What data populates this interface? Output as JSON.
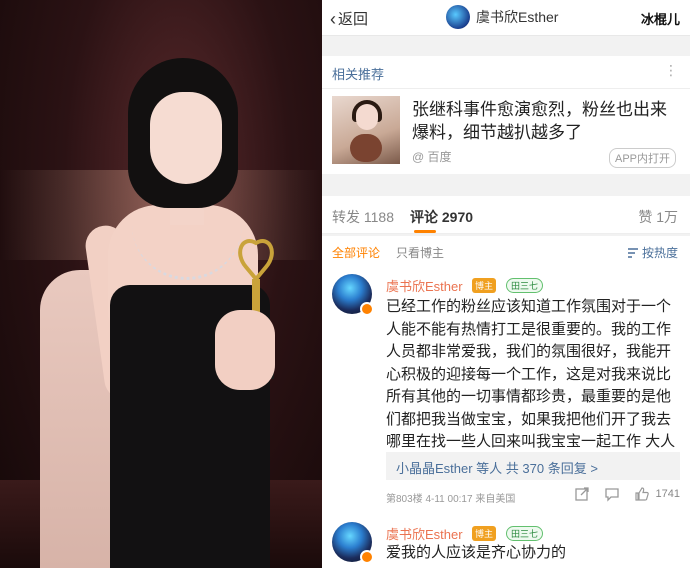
{
  "nav": {
    "back_label": "返回",
    "user_name": "虞书欣Esther",
    "watermark": "冰棍儿"
  },
  "recommend": {
    "header": "相关推荐",
    "title": "张继科事件愈演愈烈，粉丝也出来爆料，细节越扒越多了",
    "source": "@ 百度",
    "badge": "APP内打开"
  },
  "stats": {
    "repost": "转发 1188",
    "comments": "评论 2970",
    "likes": "赞 1万"
  },
  "filters": {
    "all": "全部评论",
    "owner_only": "只看博主",
    "sort": "按热度"
  },
  "comments": [
    {
      "name": "虞书欣Esther",
      "owner_tag": "博主",
      "fan_tag": "田三七",
      "text": "已经工作的粉丝应该知道工作氛围对于一个人能不能有热情打工是很重要的。我的工作人员都非常爱我，我们的氛围很好，我能开心积极的迎接每一个工作，这是对我来说比所有其他的一切事情都珍贵，最重要的是他们都把我当做宝宝，如果我把他们开了我去哪里在找一些人回来叫我宝宝一起工作  大人天真不违背",
      "reply_summary": "小晶晶Esther 等人  共 370 条回复 >",
      "meta": "第803楼  4-11 00:17  来自美国",
      "like_count": "1741"
    },
    {
      "name": "虞书欣Esther",
      "owner_tag": "博主",
      "fan_tag": "田三七",
      "text": "爱我的人应该是齐心协力的"
    }
  ],
  "colors": {
    "accent": "#ff8200",
    "link": "#4a6f9a",
    "username": "#eb7350"
  },
  "icons": [
    "back-chevron-icon",
    "more-icon",
    "sort-icon",
    "reply-icon",
    "share-icon",
    "comment-icon",
    "like-icon",
    "verified-badge-icon"
  ]
}
